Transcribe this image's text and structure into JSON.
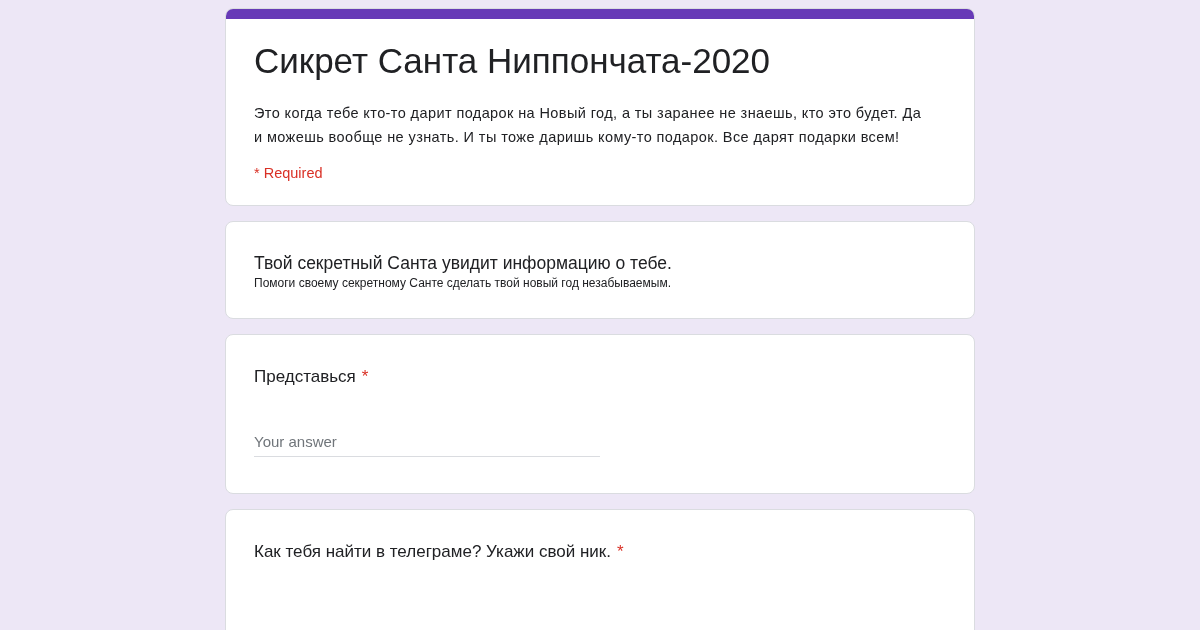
{
  "form": {
    "title": "Сикрет Санта Ниппончата-2020",
    "description": "Это когда тебе кто-то дарит подарок на Новый год, а ты заранее не знаешь, кто это будет. Да и можешь вообще не узнать. И ты тоже даришь кому-то подарок. Все дарят подарки всем!",
    "required_note": "* Required"
  },
  "items": [
    {
      "kind": "section",
      "title": "Твой секретный Санта увидит информацию о тебе.",
      "description": "Помоги своему секретному Санте сделать твой новый год незабываемым."
    },
    {
      "kind": "question",
      "title": "Представься",
      "required_mark": "*",
      "placeholder": "Your answer"
    },
    {
      "kind": "question",
      "title": "Как тебя найти в телеграме? Укажи свой ник.",
      "required_mark": "*"
    }
  ]
}
